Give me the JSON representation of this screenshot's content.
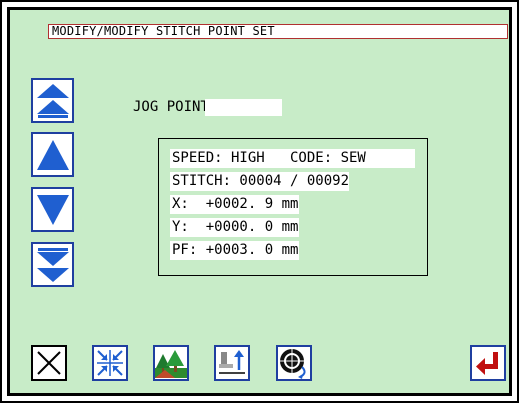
{
  "screen": {
    "title": "MODIFY/MODIFY STITCH  POINT SET"
  },
  "nav_buttons": [
    {
      "icon": "double-up-arrow-icon"
    },
    {
      "icon": "up-arrow-icon"
    },
    {
      "icon": "down-arrow-icon"
    },
    {
      "icon": "double-down-arrow-icon"
    }
  ],
  "jog": {
    "label": "JOG POINT",
    "value": ""
  },
  "info": {
    "speed": "SPEED: HIGH   CODE: SEW ",
    "stitch": "STITCH: 00004 / 00092",
    "x": "X:  +0002. 9 mm",
    "y": "Y:  +0000. 0 mm",
    "pf": "PF: +0003. 0 mm"
  },
  "toolbar": [
    {
      "icon": "cancel-x-icon"
    },
    {
      "icon": "center-arrows-icon"
    },
    {
      "icon": "trees-landscape-icon"
    },
    {
      "icon": "presser-foot-up-icon"
    },
    {
      "icon": "handwheel-rotate-icon"
    },
    {
      "icon": "enter-return-icon"
    }
  ],
  "colors": {
    "screen_background": "#c8ecc8",
    "button_border": "#1f3fa0",
    "arrow_fill": "#1f5fd0",
    "enter_icon": "#c01010"
  }
}
